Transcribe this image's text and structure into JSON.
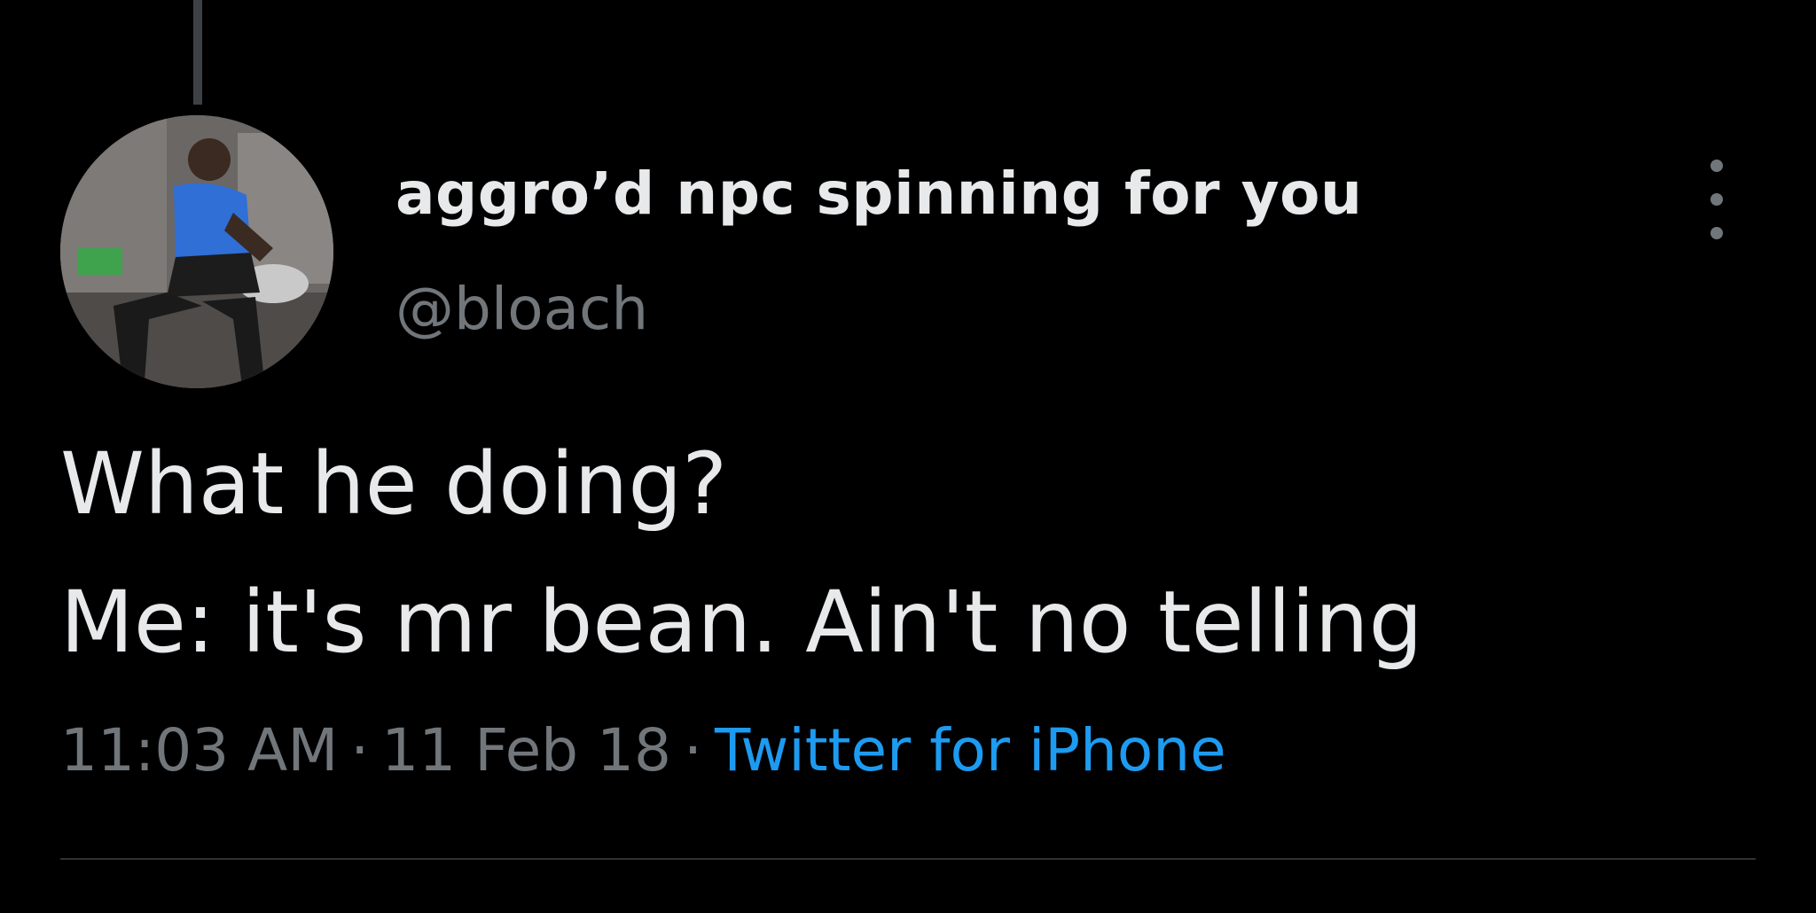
{
  "tweet": {
    "display_name": "aggro’d npc spinning for you",
    "handle": "@bloach",
    "text_lines": [
      "What he doing?",
      "Me: it's mr bean. Ain't no telling"
    ],
    "time": "11:03 AM",
    "separator": "·",
    "date": "11 Feb 18",
    "source": "Twitter for iPhone"
  },
  "icons": {
    "more": "more-options-icon",
    "avatar": "profile-avatar"
  },
  "colors": {
    "background": "#000000",
    "primary_text": "#e7e9ea",
    "secondary_text": "#71767b",
    "link": "#1d9bf0",
    "divider": "#2f3336"
  }
}
